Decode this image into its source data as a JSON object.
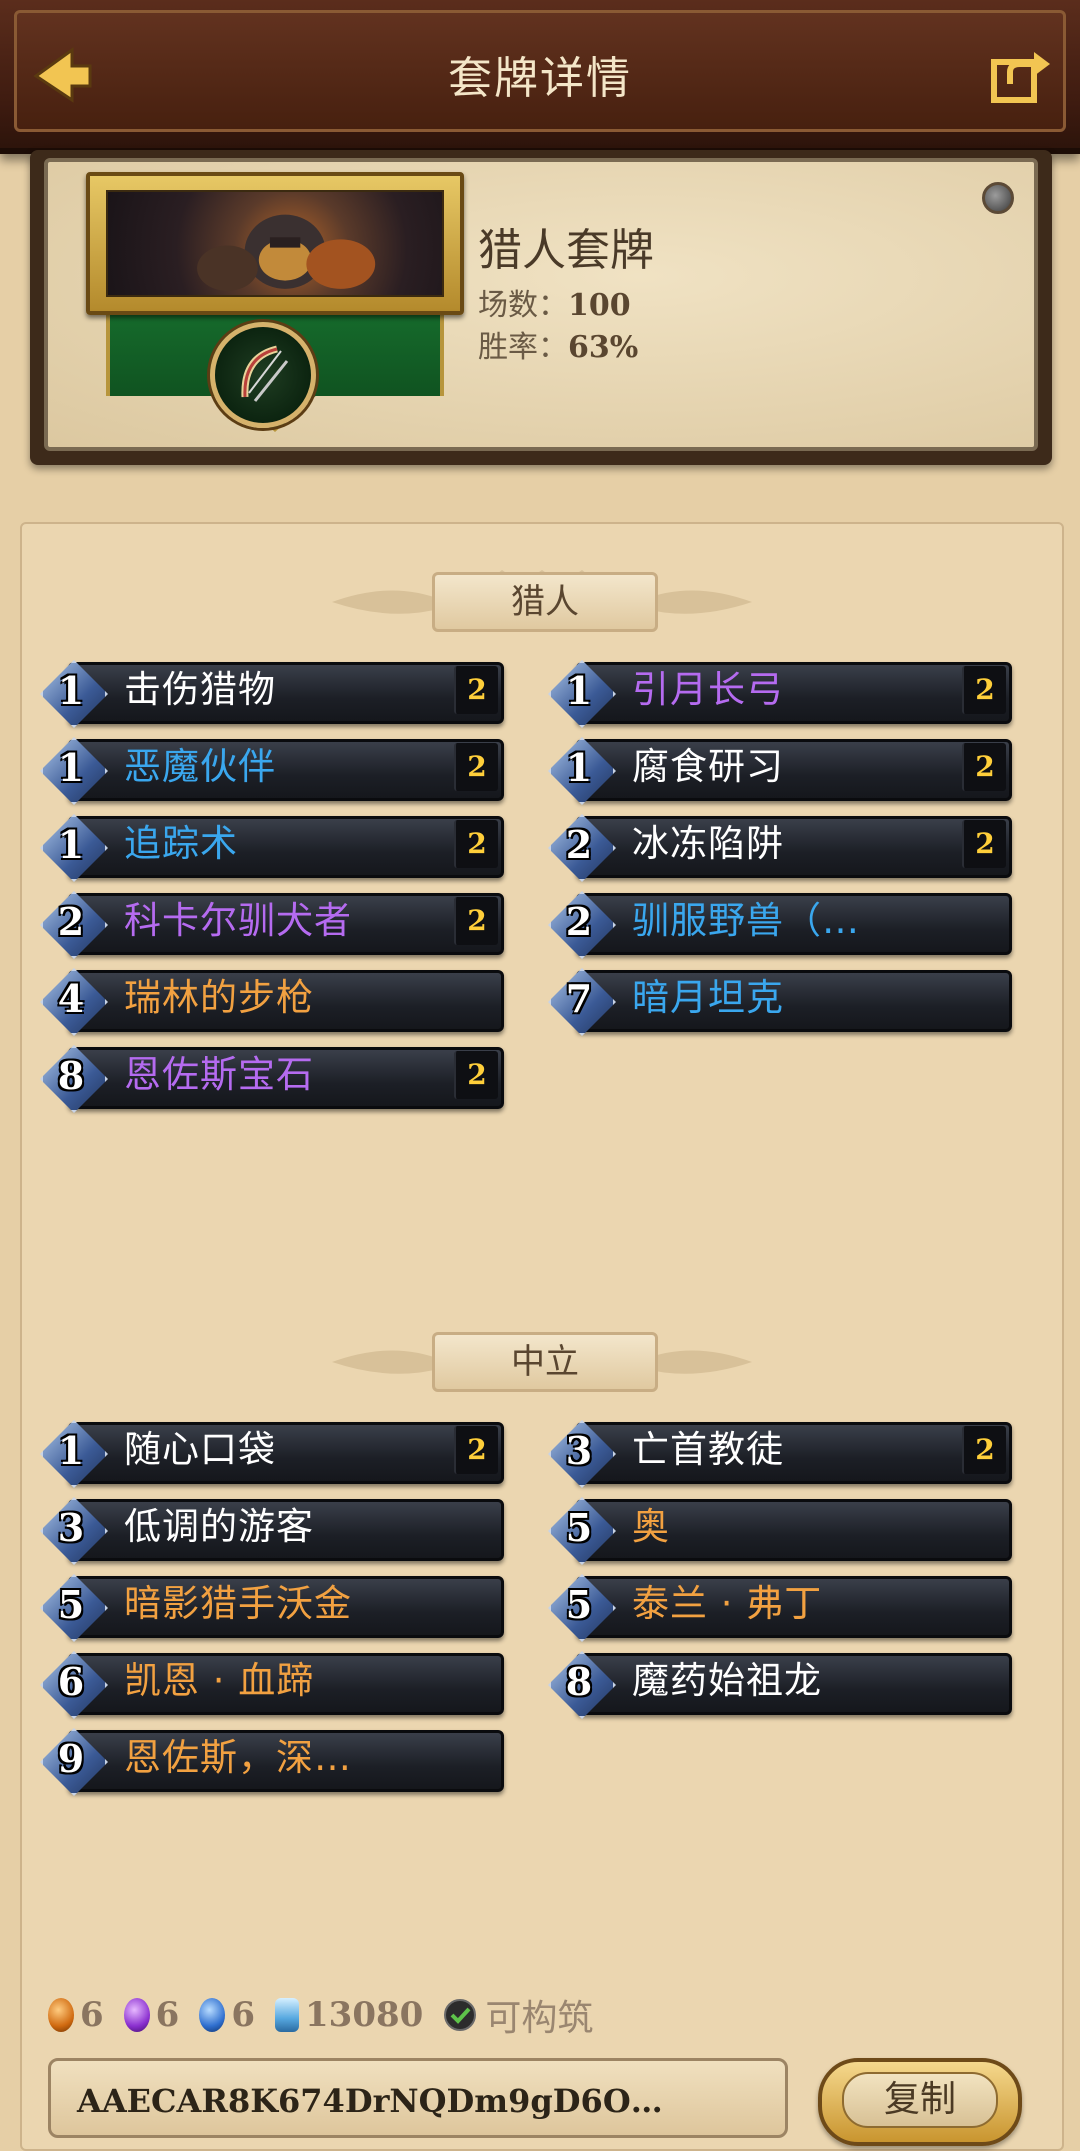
{
  "header": {
    "title": "套牌详情",
    "back_icon": "back-arrow-icon",
    "share_icon": "share-icon"
  },
  "deck": {
    "name": "猎人套牌",
    "games_label": "场数：",
    "games_value": "100",
    "winrate_label": "胜率：",
    "winrate_value": "63%",
    "hero_portrait": "hunter-hero-portrait",
    "class_icon": "bow-icon"
  },
  "sections": {
    "hunter": {
      "title": "猎人",
      "cards": [
        {
          "cost": "1",
          "name": "击伤猎物",
          "rarity": "common",
          "count": "2"
        },
        {
          "cost": "1",
          "name": "引月长弓",
          "rarity": "epic",
          "count": "2"
        },
        {
          "cost": "1",
          "name": "恶魔伙伴",
          "rarity": "rare",
          "count": "2"
        },
        {
          "cost": "1",
          "name": "腐食研习",
          "rarity": "common",
          "count": "2"
        },
        {
          "cost": "1",
          "name": "追踪术",
          "rarity": "rare",
          "count": "2"
        },
        {
          "cost": "2",
          "name": "冰冻陷阱",
          "rarity": "common",
          "count": "2"
        },
        {
          "cost": "2",
          "name": "科卡尔驯犬者",
          "rarity": "epic",
          "count": "2"
        },
        {
          "cost": "2",
          "name": "驯服野兽（…",
          "rarity": "rare",
          "count": ""
        },
        {
          "cost": "4",
          "name": "瑞林的步枪",
          "rarity": "legendary",
          "count": ""
        },
        {
          "cost": "7",
          "name": "暗月坦克",
          "rarity": "rare",
          "count": ""
        },
        {
          "cost": "8",
          "name": "恩佐斯宝石",
          "rarity": "epic",
          "count": "2"
        }
      ]
    },
    "neutral": {
      "title": "中立",
      "cards": [
        {
          "cost": "1",
          "name": "随心口袋",
          "rarity": "common",
          "count": "2"
        },
        {
          "cost": "3",
          "name": "亡首教徒",
          "rarity": "common",
          "count": "2"
        },
        {
          "cost": "3",
          "name": "低调的游客",
          "rarity": "common",
          "count": ""
        },
        {
          "cost": "5",
          "name": "奥",
          "rarity": "legendary",
          "count": ""
        },
        {
          "cost": "5",
          "name": "暗影猎手沃金",
          "rarity": "legendary",
          "count": ""
        },
        {
          "cost": "5",
          "name": "泰兰 · 弗丁",
          "rarity": "legendary",
          "count": ""
        },
        {
          "cost": "6",
          "name": "凯恩 · 血蹄",
          "rarity": "legendary",
          "count": ""
        },
        {
          "cost": "8",
          "name": "魔药始祖龙",
          "rarity": "common",
          "count": ""
        },
        {
          "cost": "9",
          "name": "恩佐斯，深…",
          "rarity": "legendary",
          "count": ""
        }
      ]
    }
  },
  "footer": {
    "legendary_count": "6",
    "epic_count": "6",
    "rare_count": "6",
    "dust_cost": "13080",
    "craftable_label": "可构筑",
    "deck_code": "AAECAR8K674DrNQDm9gD6O…",
    "copy_label": "复制"
  },
  "colors": {
    "common": "#ffffff",
    "rare": "#3aa7ee",
    "epic": "#b56bf0",
    "legendary": "#f2a141",
    "count": "#ffcf3a",
    "header_bg": "#4a2414",
    "panel_bg": "#ebd6b0"
  }
}
